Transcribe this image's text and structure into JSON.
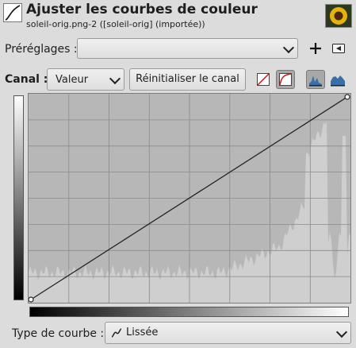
{
  "header": {
    "title": "Ajuster les courbes de couleur",
    "subtitle": "soleil-orig.png-2 ([soleil-orig] (importée))",
    "app_icon": "curves-icon",
    "thumbnail": "sunflower-image-thumbnail"
  },
  "presets": {
    "label": "Préréglages :",
    "value": "",
    "add_icon": "plus-icon",
    "menu_icon": "triangle-left-icon"
  },
  "channel": {
    "label": "Canal :",
    "value": "Valeur",
    "reset_label": "Réinitialiser le canal",
    "mode_icons": [
      "linear-curve-icon",
      "log-curve-icon",
      "linear-histogram-icon",
      "log-histogram-icon"
    ],
    "pressed_modes": [
      "log-curve-icon",
      "linear-histogram-icon"
    ]
  },
  "curve": {
    "grid_divisions": 8,
    "points": [
      [
        0,
        0
      ],
      [
        255,
        255
      ]
    ]
  },
  "curve_type": {
    "label": "Type de courbe :",
    "value": "Lissée",
    "icon": "smooth-curve-icon"
  },
  "colors": {
    "background": "#dcdcdc",
    "curve_bg": "#b7b7b7",
    "histogram": "#cfcfcf",
    "grid": "#8a8a8a",
    "curve_line": "#222222"
  }
}
